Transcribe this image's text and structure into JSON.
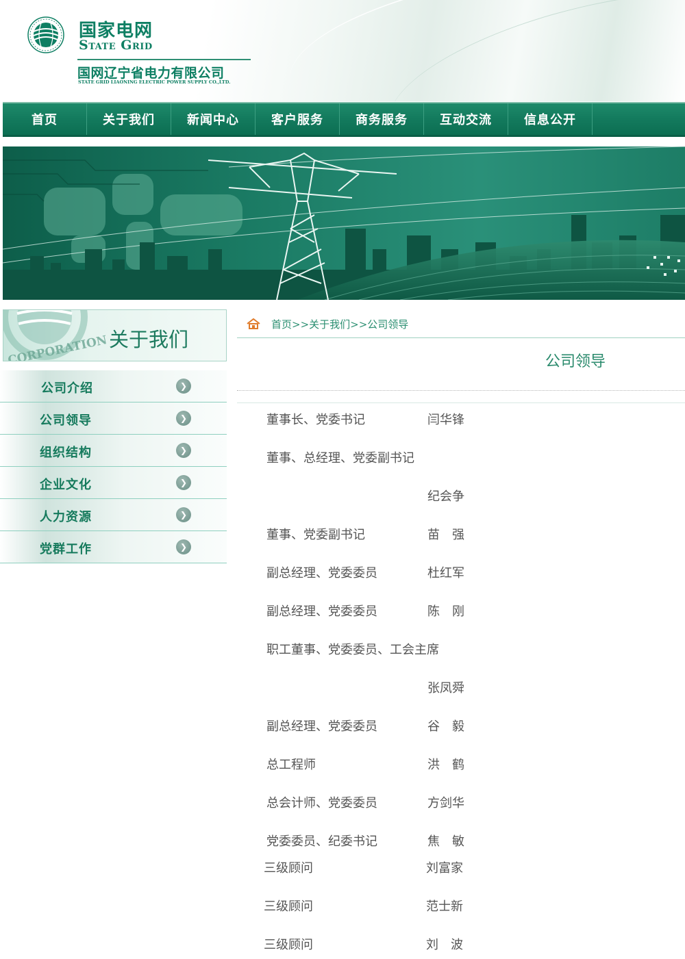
{
  "header": {
    "logo_cn": "国家电网",
    "logo_en": "State Grid",
    "company_cn": "国网辽宁省电力有限公司",
    "company_en": "STATE GRID LIAONING ELECTRIC POWER SUPPLY CO.,LTD."
  },
  "nav": [
    "首页",
    "关于我们",
    "新闻中心",
    "客户服务",
    "商务服务",
    "互动交流",
    "信息公开"
  ],
  "sidebar": {
    "title": "关于我们",
    "items": [
      "公司介绍",
      "公司领导",
      "组织结构",
      "企业文化",
      "人力资源",
      "党群工作"
    ]
  },
  "breadcrumb": "首页>>关于我们>>公司领导",
  "page_title": "公司领导",
  "leaders": [
    {
      "title": "董事长、党委书记",
      "name": "闫华锋"
    },
    {
      "title": "董事、总经理、党委副书记",
      "name": ""
    },
    {
      "title": "",
      "name": "纪会争"
    },
    {
      "title": "董事、党委副书记",
      "name": "苗　强"
    },
    {
      "title": "副总经理、党委委员",
      "name": "杜红军"
    },
    {
      "title": "副总经理、党委委员",
      "name": "陈　刚"
    },
    {
      "title": "职工董事、党委委员、工会主席",
      "name": ""
    },
    {
      "title": "",
      "name": "张凤舜"
    },
    {
      "title": "副总经理、党委委员",
      "name": "谷　毅"
    },
    {
      "title": "总工程师",
      "name": "洪　鹤"
    },
    {
      "title": "总会计师、党委委员",
      "name": "方剑华"
    },
    {
      "title": "党委委员、纪委书记",
      "name": "焦　敏"
    },
    {
      "title": "三级顾问",
      "name": "刘富家"
    },
    {
      "title": "三级顾问",
      "name": "范士新"
    },
    {
      "title": "三级顾问",
      "name": "刘　波"
    }
  ],
  "colors": {
    "brand_green": "#0e7f63",
    "nav_green": "#137a5d",
    "text_gray": "#555555"
  }
}
